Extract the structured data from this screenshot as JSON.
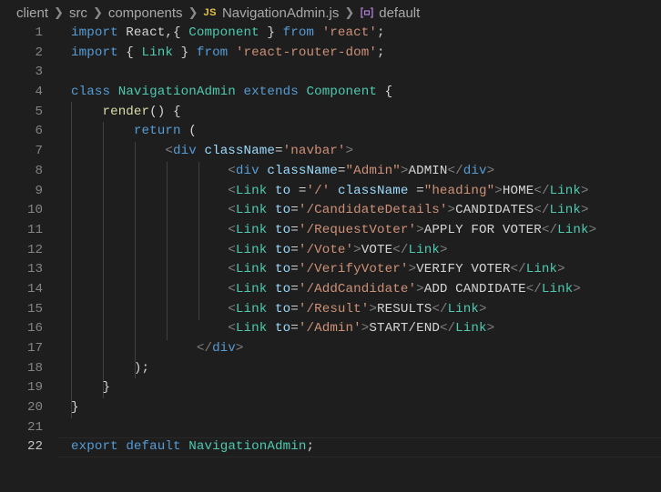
{
  "breadcrumb": {
    "items": [
      "client",
      "src",
      "components"
    ],
    "file_badge": "JS",
    "file": "NavigationAdmin.js",
    "symbol": "default"
  },
  "editor": {
    "active_line": 22,
    "lines": [
      {
        "n": "1",
        "tokens": [
          [
            "k",
            "import"
          ],
          [
            "d",
            " React,{ "
          ],
          [
            "c",
            "Component"
          ],
          [
            "d",
            " } "
          ],
          [
            "k",
            "from"
          ],
          [
            "d",
            " "
          ],
          [
            "s",
            "'react'"
          ],
          [
            "d",
            ";"
          ]
        ]
      },
      {
        "n": "2",
        "tokens": [
          [
            "k",
            "import"
          ],
          [
            "d",
            " { "
          ],
          [
            "c",
            "Link"
          ],
          [
            "d",
            " } "
          ],
          [
            "k",
            "from"
          ],
          [
            "d",
            " "
          ],
          [
            "s",
            "'react-router-dom'"
          ],
          [
            "d",
            ";"
          ]
        ]
      },
      {
        "n": "3",
        "tokens": []
      },
      {
        "n": "4",
        "tokens": [
          [
            "k",
            "class"
          ],
          [
            "d",
            " "
          ],
          [
            "c",
            "NavigationAdmin"
          ],
          [
            "d",
            " "
          ],
          [
            "k",
            "extends"
          ],
          [
            "d",
            " "
          ],
          [
            "c",
            "Component"
          ],
          [
            "d",
            " {"
          ]
        ]
      },
      {
        "n": "5",
        "tokens": [
          [
            "d",
            "    "
          ],
          [
            "f",
            "render"
          ],
          [
            "d",
            "() {"
          ]
        ]
      },
      {
        "n": "6",
        "tokens": [
          [
            "d",
            "        "
          ],
          [
            "k",
            "return"
          ],
          [
            "d",
            " ("
          ]
        ]
      },
      {
        "n": "7",
        "tokens": [
          [
            "d",
            "            "
          ],
          [
            "p",
            "<"
          ],
          [
            "t",
            "div"
          ],
          [
            "d",
            " "
          ],
          [
            "v",
            "className"
          ],
          [
            "d",
            "="
          ],
          [
            "s",
            "'navbar'"
          ],
          [
            "p",
            ">"
          ]
        ]
      },
      {
        "n": "8",
        "tokens": [
          [
            "d",
            "                    "
          ],
          [
            "p",
            "<"
          ],
          [
            "t",
            "div"
          ],
          [
            "d",
            " "
          ],
          [
            "v",
            "className"
          ],
          [
            "d",
            "="
          ],
          [
            "s",
            "\"Admin\""
          ],
          [
            "p",
            ">"
          ],
          [
            "d",
            "ADMIN"
          ],
          [
            "p",
            "</"
          ],
          [
            "t",
            "div"
          ],
          [
            "p",
            ">"
          ]
        ]
      },
      {
        "n": "9",
        "tokens": [
          [
            "d",
            "                    "
          ],
          [
            "p",
            "<"
          ],
          [
            "c",
            "Link"
          ],
          [
            "d",
            " "
          ],
          [
            "v",
            "to"
          ],
          [
            "d",
            " ="
          ],
          [
            "s",
            "'/'"
          ],
          [
            "d",
            " "
          ],
          [
            "v",
            "className"
          ],
          [
            "d",
            " ="
          ],
          [
            "s",
            "\"heading\""
          ],
          [
            "p",
            ">"
          ],
          [
            "d",
            "HOME"
          ],
          [
            "p",
            "</"
          ],
          [
            "c",
            "Link"
          ],
          [
            "p",
            ">"
          ]
        ]
      },
      {
        "n": "10",
        "tokens": [
          [
            "d",
            "                    "
          ],
          [
            "p",
            "<"
          ],
          [
            "c",
            "Link"
          ],
          [
            "d",
            " "
          ],
          [
            "v",
            "to"
          ],
          [
            "d",
            "="
          ],
          [
            "s",
            "'/CandidateDetails'"
          ],
          [
            "p",
            ">"
          ],
          [
            "d",
            "CANDIDATES"
          ],
          [
            "p",
            "</"
          ],
          [
            "c",
            "Link"
          ],
          [
            "p",
            ">"
          ]
        ]
      },
      {
        "n": "11",
        "tokens": [
          [
            "d",
            "                    "
          ],
          [
            "p",
            "<"
          ],
          [
            "c",
            "Link"
          ],
          [
            "d",
            " "
          ],
          [
            "v",
            "to"
          ],
          [
            "d",
            "="
          ],
          [
            "s",
            "'/RequestVoter'"
          ],
          [
            "p",
            ">"
          ],
          [
            "d",
            "APPLY FOR VOTER"
          ],
          [
            "p",
            "</"
          ],
          [
            "c",
            "Link"
          ],
          [
            "p",
            ">"
          ]
        ]
      },
      {
        "n": "12",
        "tokens": [
          [
            "d",
            "                    "
          ],
          [
            "p",
            "<"
          ],
          [
            "c",
            "Link"
          ],
          [
            "d",
            " "
          ],
          [
            "v",
            "to"
          ],
          [
            "d",
            "="
          ],
          [
            "s",
            "'/Vote'"
          ],
          [
            "p",
            ">"
          ],
          [
            "d",
            "VOTE"
          ],
          [
            "p",
            "</"
          ],
          [
            "c",
            "Link"
          ],
          [
            "p",
            ">"
          ]
        ]
      },
      {
        "n": "13",
        "tokens": [
          [
            "d",
            "                    "
          ],
          [
            "p",
            "<"
          ],
          [
            "c",
            "Link"
          ],
          [
            "d",
            " "
          ],
          [
            "v",
            "to"
          ],
          [
            "d",
            "="
          ],
          [
            "s",
            "'/VerifyVoter'"
          ],
          [
            "p",
            ">"
          ],
          [
            "d",
            "VERIFY VOTER"
          ],
          [
            "p",
            "</"
          ],
          [
            "c",
            "Link"
          ],
          [
            "p",
            ">"
          ]
        ]
      },
      {
        "n": "14",
        "tokens": [
          [
            "d",
            "                    "
          ],
          [
            "p",
            "<"
          ],
          [
            "c",
            "Link"
          ],
          [
            "d",
            " "
          ],
          [
            "v",
            "to"
          ],
          [
            "d",
            "="
          ],
          [
            "s",
            "'/AddCandidate'"
          ],
          [
            "p",
            ">"
          ],
          [
            "d",
            "ADD CANDIDATE"
          ],
          [
            "p",
            "</"
          ],
          [
            "c",
            "Link"
          ],
          [
            "p",
            ">"
          ]
        ]
      },
      {
        "n": "15",
        "tokens": [
          [
            "d",
            "                    "
          ],
          [
            "p",
            "<"
          ],
          [
            "c",
            "Link"
          ],
          [
            "d",
            " "
          ],
          [
            "v",
            "to"
          ],
          [
            "d",
            "="
          ],
          [
            "s",
            "'/Result'"
          ],
          [
            "p",
            ">"
          ],
          [
            "d",
            "RESULTS"
          ],
          [
            "p",
            "</"
          ],
          [
            "c",
            "Link"
          ],
          [
            "p",
            ">"
          ]
        ]
      },
      {
        "n": "16",
        "tokens": [
          [
            "d",
            "                    "
          ],
          [
            "p",
            "<"
          ],
          [
            "c",
            "Link"
          ],
          [
            "d",
            " "
          ],
          [
            "v",
            "to"
          ],
          [
            "d",
            "="
          ],
          [
            "s",
            "'/Admin'"
          ],
          [
            "p",
            ">"
          ],
          [
            "d",
            "START/END"
          ],
          [
            "p",
            "</"
          ],
          [
            "c",
            "Link"
          ],
          [
            "p",
            ">"
          ]
        ]
      },
      {
        "n": "17",
        "tokens": [
          [
            "d",
            "                "
          ],
          [
            "p",
            "</"
          ],
          [
            "t",
            "div"
          ],
          [
            "p",
            ">"
          ]
        ]
      },
      {
        "n": "18",
        "tokens": [
          [
            "d",
            "        );"
          ]
        ]
      },
      {
        "n": "19",
        "tokens": [
          [
            "d",
            "    }"
          ]
        ]
      },
      {
        "n": "20",
        "tokens": [
          [
            "d",
            "}"
          ]
        ]
      },
      {
        "n": "21",
        "tokens": []
      },
      {
        "n": "22",
        "tokens": [
          [
            "k",
            "export"
          ],
          [
            "d",
            " "
          ],
          [
            "k",
            "default"
          ],
          [
            "d",
            " "
          ],
          [
            "c",
            "NavigationAdmin"
          ],
          [
            "d",
            ";"
          ]
        ]
      }
    ]
  },
  "colors": {
    "background": "#1e1e1e",
    "keyword": "#569cd6",
    "string": "#ce9178",
    "type": "#4ec9b0",
    "function": "#dcdcaa",
    "attribute": "#9cdcfe",
    "line_number": "#858585"
  },
  "icons": {
    "file_icon": "javascript-file-icon",
    "symbol_icon": "symbol-variable-icon",
    "separator_icon": "chevron-right-icon"
  }
}
